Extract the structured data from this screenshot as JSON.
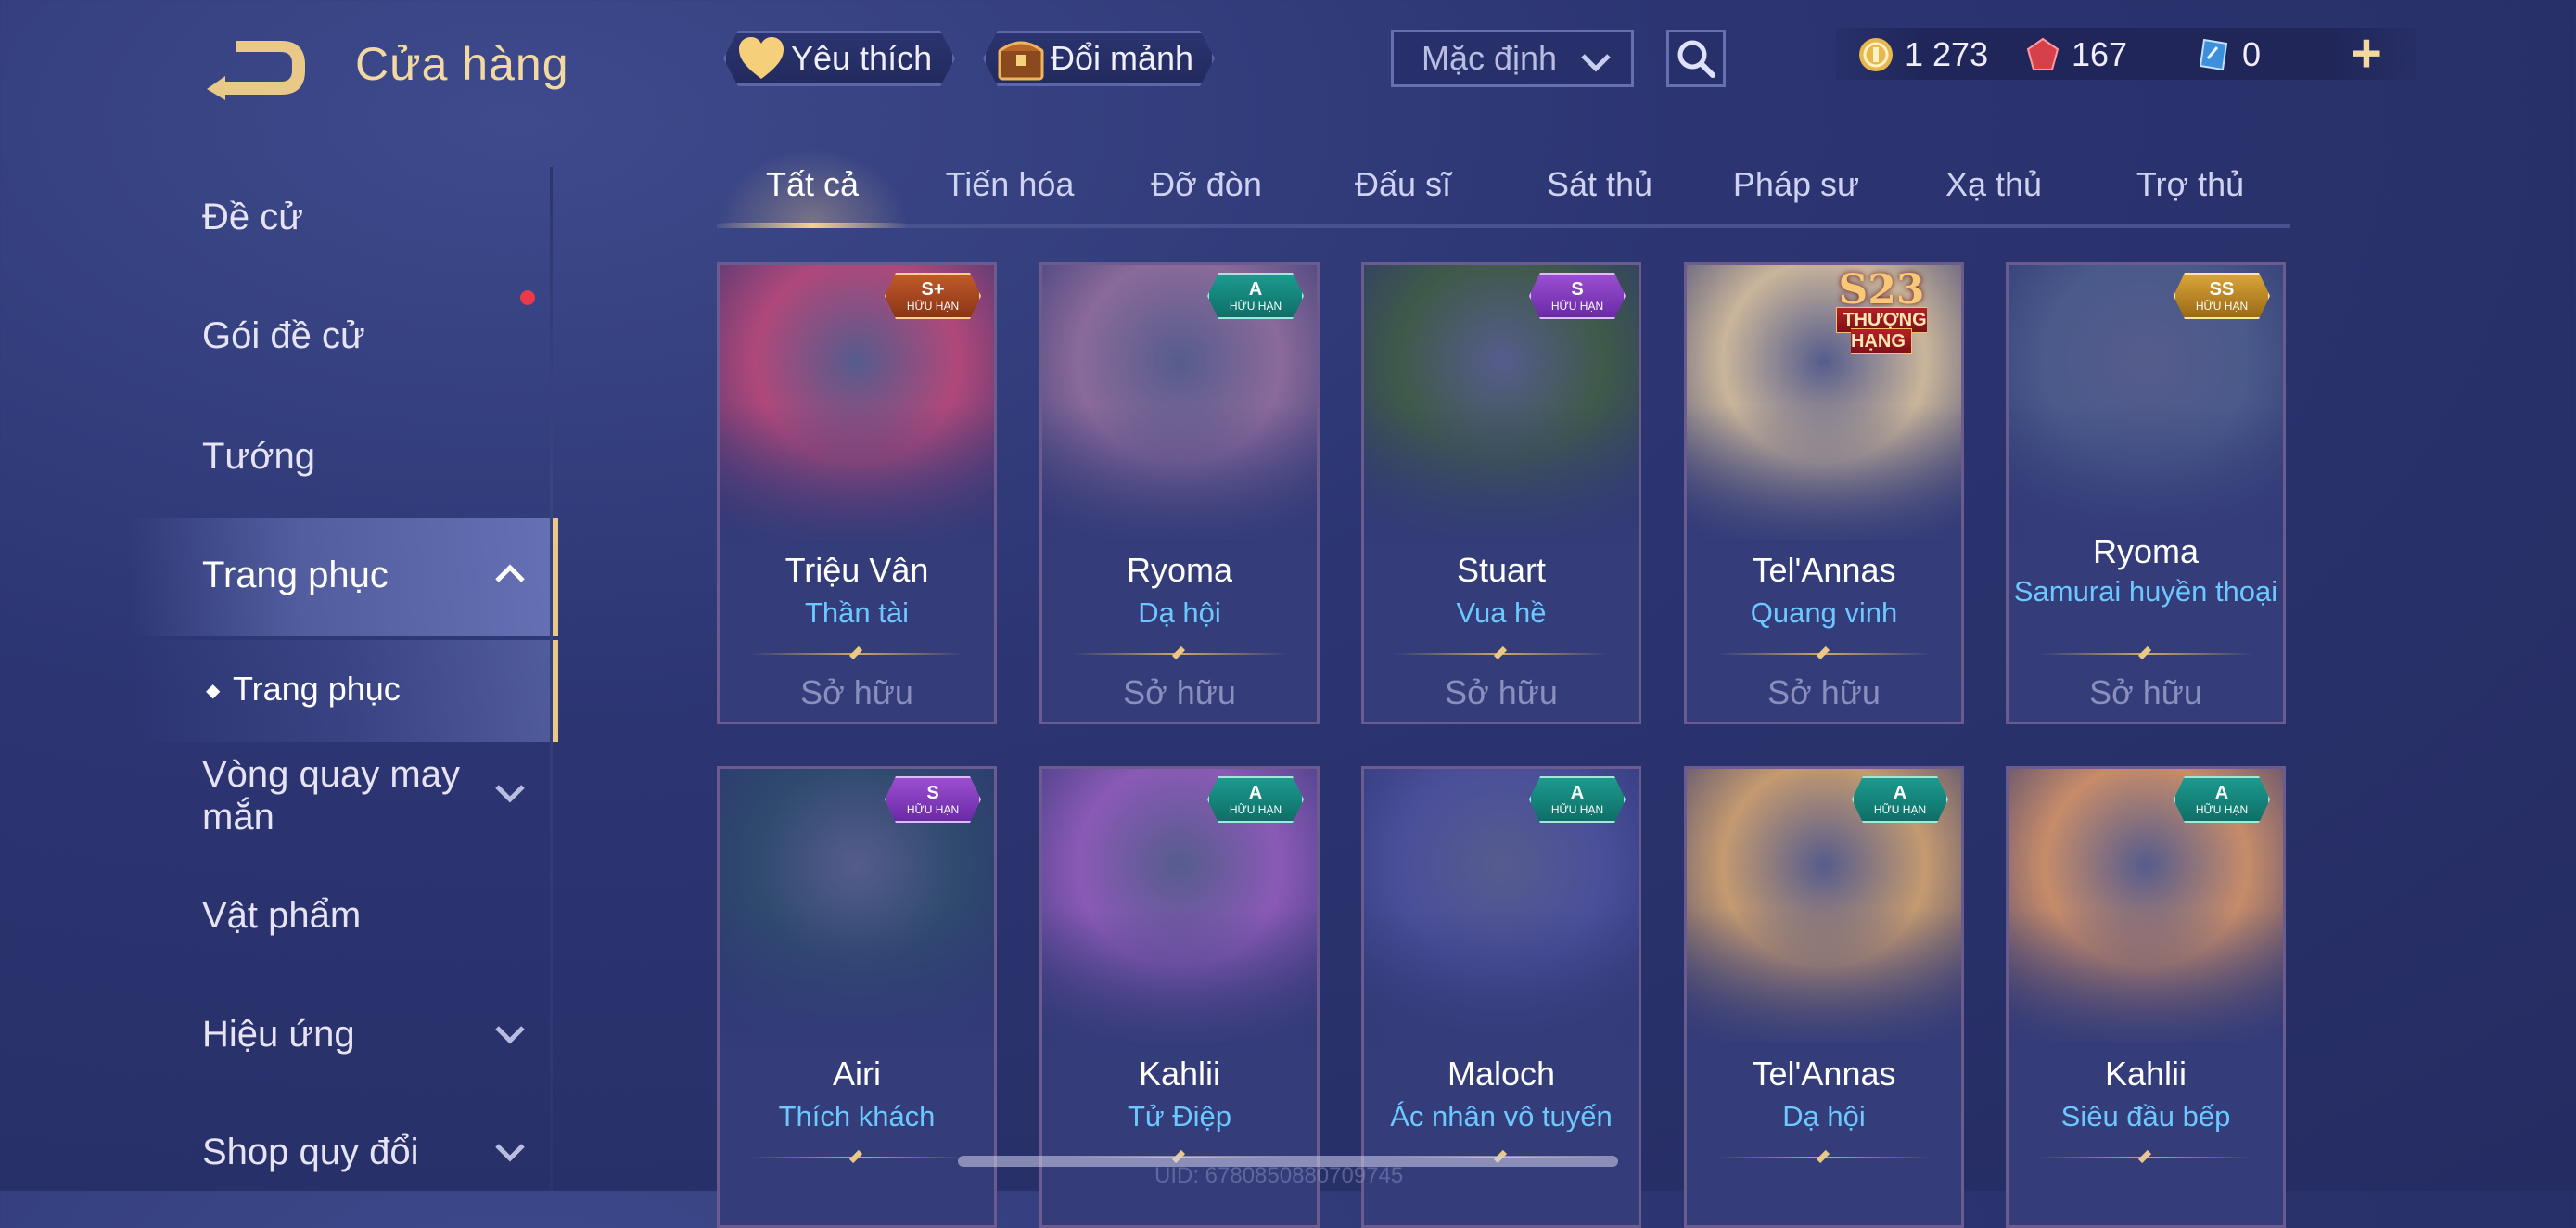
{
  "header": {
    "title": "Cửa hàng",
    "favorite_label": "Yêu thích",
    "shard_label": "Đổi mảnh",
    "sort_value": "Mặc định",
    "currencies": [
      {
        "name": "gold-coin",
        "value": "1 273"
      },
      {
        "name": "red-gem",
        "value": "167"
      },
      {
        "name": "voucher",
        "value": "0"
      }
    ],
    "plus_label": "+"
  },
  "sidebar": {
    "items": [
      {
        "label": "Đề cử"
      },
      {
        "label": "Gói đề cử"
      },
      {
        "label": "Tướng"
      },
      {
        "label": "Trang phục"
      },
      {
        "label": "Trang phục"
      },
      {
        "label": "Vòng quay may mắn"
      },
      {
        "label": "Vật phẩm"
      },
      {
        "label": "Hiệu ứng"
      },
      {
        "label": "Shop quy đổi"
      }
    ]
  },
  "tabs": [
    "Tất cả",
    "Tiến hóa",
    "Đỡ đòn",
    "Đấu sĩ",
    "Sát thủ",
    "Pháp sư",
    "Xạ thủ",
    "Trợ thủ"
  ],
  "cards": [
    {
      "hero": "Triệu Vân",
      "skin": "Thần tài",
      "status": "Sở hữu",
      "tier": "S+",
      "limited": "HỮU HẠN",
      "art_color": "#b0487a"
    },
    {
      "hero": "Ryoma",
      "skin": "Dạ hội",
      "status": "Sở hữu",
      "tier": "A",
      "limited": "HỮU HẠN",
      "art_color": "#8a6a9a"
    },
    {
      "hero": "Stuart",
      "skin": "Vua hề",
      "status": "Sở hữu",
      "tier": "S",
      "limited": "HỮU HẠN",
      "art_color": "#3f5a4a"
    },
    {
      "hero": "Tel'Annas",
      "skin": "Quang vinh",
      "status": "Sở hữu",
      "tier": "S23",
      "limited": "THƯỢNG HẠNG",
      "art_color": "#c9b59a"
    },
    {
      "hero": "Ryoma",
      "skin": "Samurai huyền thoại",
      "status": "Sở hữu",
      "tier": "SS",
      "limited": "HỮU HẠN",
      "art_color": "#4a5a8a"
    },
    {
      "hero": "Airi",
      "skin": "Thích khách",
      "status": "",
      "tier": "S",
      "limited": "HỮU HẠN",
      "art_color": "#2f4a6e"
    },
    {
      "hero": "Kahlii",
      "skin": "Tử Điệp",
      "status": "",
      "tier": "A",
      "limited": "HỮU HẠN",
      "art_color": "#8a5ab6"
    },
    {
      "hero": "Maloch",
      "skin": "Ác nhân vô tuyến",
      "status": "",
      "tier": "A",
      "limited": "HỮU HẠN",
      "art_color": "#4a4f9a"
    },
    {
      "hero": "Tel'Annas",
      "skin": "Dạ hội",
      "status": "",
      "tier": "A",
      "limited": "HỮU HẠN",
      "art_color": "#c49a70"
    },
    {
      "hero": "Kahlii",
      "skin": "Siêu đầu bếp",
      "status": "",
      "tier": "A",
      "limited": "HỮU HẠN",
      "art_color": "#c78c6a"
    }
  ],
  "footer": {
    "uid": "UID: 6780850880709745"
  },
  "colors": {
    "accent_gold": "#e9c987",
    "skin_name_blue": "#6cc8ff",
    "bg": "#2c3572"
  }
}
